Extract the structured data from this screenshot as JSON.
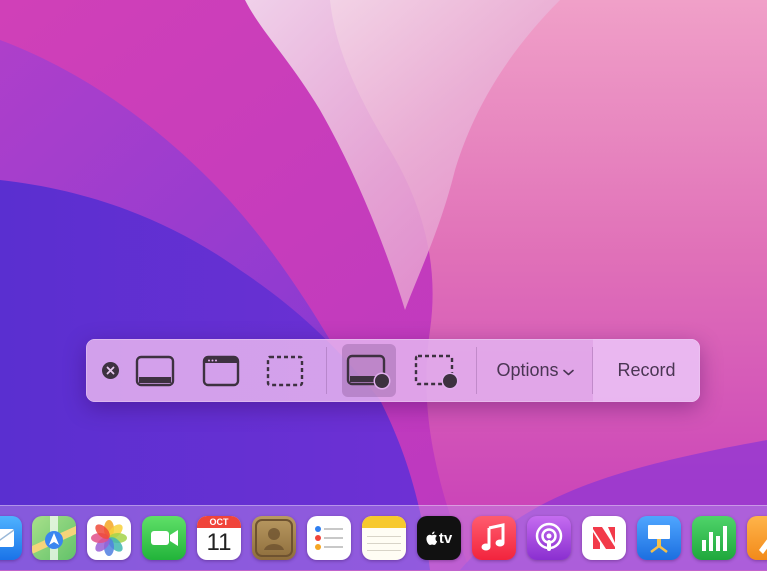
{
  "toolbar": {
    "options_label": "Options",
    "record_label": "Record"
  },
  "dock": {
    "calendar_month": "OCT",
    "calendar_day": "11",
    "tv_label": "tv"
  },
  "icons": {
    "close": "close-icon",
    "capture_entire_screen": "capture-entire-screen-icon",
    "capture_window": "capture-window-icon",
    "capture_selection": "capture-selection-icon",
    "record_entire_screen": "record-entire-screen-icon",
    "record_selection": "record-selection-icon",
    "chevron": "chevron-down-icon"
  },
  "colors": {
    "toolbar_text": "#4a3553",
    "toolbar_icon": "#3d3140"
  }
}
